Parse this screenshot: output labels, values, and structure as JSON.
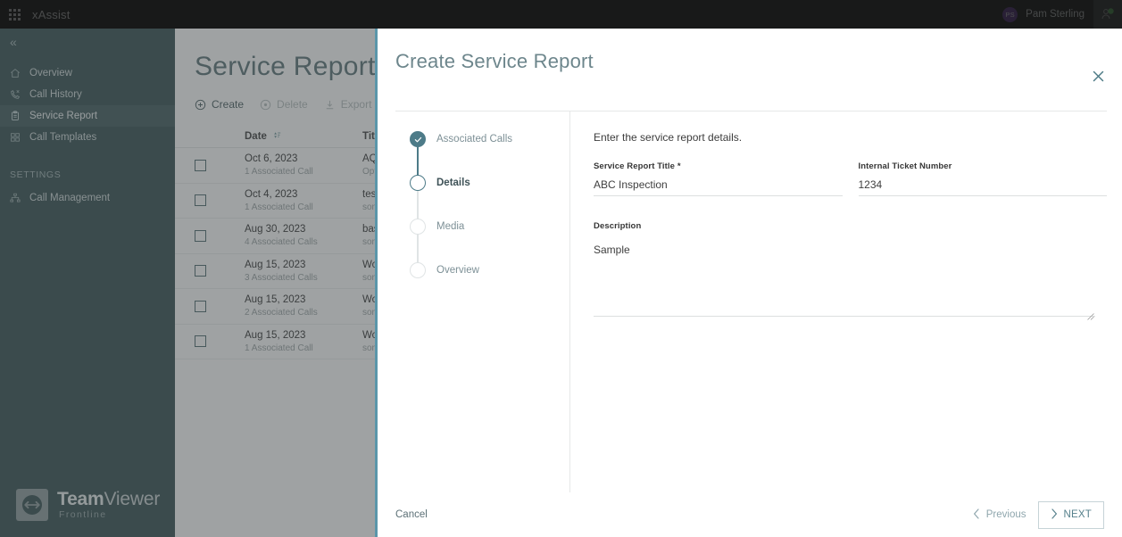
{
  "topbar": {
    "app_name": "xAssist",
    "waffle_icon": "apps-grid-icon",
    "user_initials": "PS",
    "user_name": "Pam Sterling",
    "account_icon": "account-status-icon"
  },
  "sidebar": {
    "collapse_icon": "chevron-double-left-icon",
    "items": [
      {
        "label": "Overview",
        "icon": "home-icon",
        "active": false
      },
      {
        "label": "Call History",
        "icon": "call-history-icon",
        "active": false
      },
      {
        "label": "Service Report",
        "icon": "clipboard-icon",
        "active": true
      },
      {
        "label": "Call Templates",
        "icon": "templates-grid-icon",
        "active": false
      }
    ],
    "section_label": "SETTINGS",
    "settings_items": [
      {
        "label": "Call Management",
        "icon": "org-tree-icon"
      }
    ],
    "logo": {
      "brand": "Team",
      "brand_light": "Viewer",
      "sub": "Frontline",
      "icon": "teamviewer-arrows-icon"
    }
  },
  "page": {
    "title": "Service Report",
    "toolbar": [
      {
        "label": "Create",
        "icon": "plus-circle-icon",
        "disabled": false
      },
      {
        "label": "Delete",
        "icon": "minus-circle-icon",
        "disabled": true
      },
      {
        "label": "Export PDF Reports",
        "icon": "download-icon",
        "disabled": true
      }
    ],
    "table": {
      "columns": [
        "Date",
        "Title"
      ],
      "sort_icon": "sort-arrows-icon",
      "rows": [
        {
          "date": "Oct 6, 2023",
          "calls": "1 Associated Call",
          "title": "AQ",
          "subtitle": "Opt"
        },
        {
          "date": "Oct 4, 2023",
          "calls": "1 Associated Call",
          "title": "tes",
          "subtitle": "son"
        },
        {
          "date": "Aug 30, 2023",
          "calls": "4 Associated Calls",
          "title": "bas",
          "subtitle": "son"
        },
        {
          "date": "Aug 15, 2023",
          "calls": "3 Associated Calls",
          "title": "Wo",
          "subtitle": "son"
        },
        {
          "date": "Aug 15, 2023",
          "calls": "2 Associated Calls",
          "title": "Wo",
          "subtitle": "son"
        },
        {
          "date": "Aug 15, 2023",
          "calls": "1 Associated Call",
          "title": "Wo",
          "subtitle": "son"
        }
      ]
    }
  },
  "modal": {
    "title": "Create Service Report",
    "close_icon": "close-icon",
    "steps": [
      {
        "label": "Associated Calls",
        "state": "done"
      },
      {
        "label": "Details",
        "state": "current"
      },
      {
        "label": "Media",
        "state": "todo"
      },
      {
        "label": "Overview",
        "state": "todo"
      }
    ],
    "panel": {
      "hint": "Enter the service report details.",
      "title_field": {
        "label": "Service Report Title",
        "required_marker": "*",
        "value": "ABC Inspection",
        "placeholder": ""
      },
      "ticket_field": {
        "label": "Internal Ticket Number",
        "value": "1234",
        "placeholder": ""
      },
      "description_field": {
        "label": "Description",
        "value": "Sample",
        "placeholder": "",
        "resize_handle_icon": "resize-grip-icon"
      }
    },
    "footer": {
      "cancel_label": "Cancel",
      "previous_label": "Previous",
      "previous_icon": "chevron-left-icon",
      "next_label": "NEXT",
      "next_icon": "chevron-right-icon"
    }
  },
  "colors": {
    "accent_teal": "#4d7b88",
    "sidebar_bg": "#2f4a4c",
    "modal_edge": "#5b96aa",
    "topbar_bg": "#0b0b0b",
    "avatar_purple": "#5c2d91",
    "status_green": "#4caf50"
  }
}
